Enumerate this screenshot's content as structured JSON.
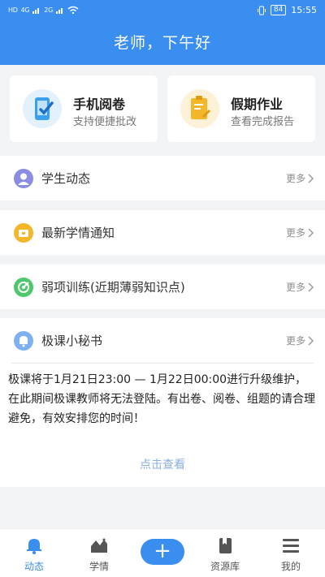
{
  "status": {
    "left_chips": [
      "HD",
      "4G",
      "2G"
    ],
    "battery": "84",
    "time": "15:55"
  },
  "greeting": "老师，下午好",
  "cards": [
    {
      "title": "手机阅卷",
      "subtitle": "支持便捷批改",
      "icon": "phone-check-icon",
      "color": "#3aa0ee"
    },
    {
      "title": "假期作业",
      "subtitle": "查看完成报告",
      "icon": "clipboard-edit-icon",
      "color": "#f5b72a"
    }
  ],
  "rows": [
    {
      "label": "学生动态",
      "more": "更多",
      "icon": "student-avatar-icon",
      "color": "#8a8ee0"
    },
    {
      "label": "最新学情通知",
      "more": "更多",
      "icon": "notice-folder-icon",
      "color": "#f5b72a"
    },
    {
      "label": "弱项训练(近期薄弱知识点)",
      "more": "更多",
      "icon": "target-icon",
      "color": "#4cc76b"
    }
  ],
  "secretary": {
    "label": "极课小秘书",
    "more": "更多",
    "icon": "bell-icon",
    "color": "#7fb1f0",
    "notice": "极课将于1月21日23:00 — 1月22日00:00进行升级维护，在此期间极课教师将无法登陆。有出卷、阅卷、组题的请合理避免，有效安排您的时间！",
    "link": "点击查看"
  },
  "tabs": [
    {
      "label": "动态",
      "icon": "bell-tab-icon",
      "active": true
    },
    {
      "label": "学情",
      "icon": "chart-tab-icon",
      "active": false
    },
    {
      "label": "",
      "icon": "plus-icon",
      "active": false
    },
    {
      "label": "资源库",
      "icon": "book-tab-icon",
      "active": false
    },
    {
      "label": "我的",
      "icon": "menu-tab-icon",
      "active": false
    }
  ],
  "colors": {
    "accent": "#3a8ef0",
    "background": "#f3f4f6"
  }
}
